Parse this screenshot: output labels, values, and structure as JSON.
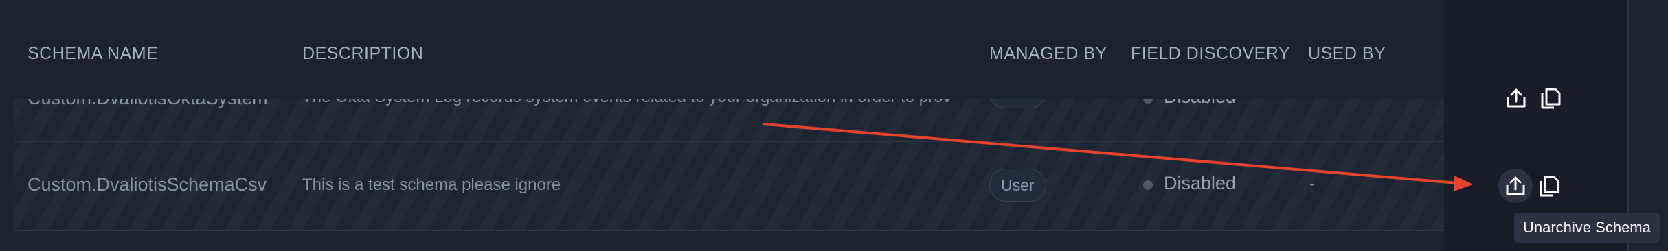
{
  "table": {
    "columns": {
      "schema_name": "SCHEMA NAME",
      "description": "DESCRIPTION",
      "managed_by": "MANAGED BY",
      "field_discovery": "FIELD DISCOVERY",
      "used_by": "USED BY"
    },
    "rows": [
      {
        "schema_name": "Custom.DvaliotisOktaSystem",
        "description": "The Okta System Log records system events related to your organization in order to prov",
        "managed_by": "User",
        "field_discovery": "Disabled",
        "used_by": ""
      },
      {
        "schema_name": "Custom.DvaliotisSchemaCsv",
        "description": "This is a test schema please ignore",
        "managed_by": "User",
        "field_discovery": "Disabled",
        "used_by": "-"
      }
    ]
  },
  "actions": {
    "unarchive_icon": "unarchive-icon",
    "duplicate_icon": "copy-icon",
    "tooltip": "Unarchive Schema"
  },
  "annotation": {
    "arrow_color": "#e5432d"
  },
  "colors": {
    "background": "#1b2230",
    "header_text": "#a4b0c5",
    "row_text": "#8792a6",
    "tooltip_bg": "#2a3243"
  }
}
